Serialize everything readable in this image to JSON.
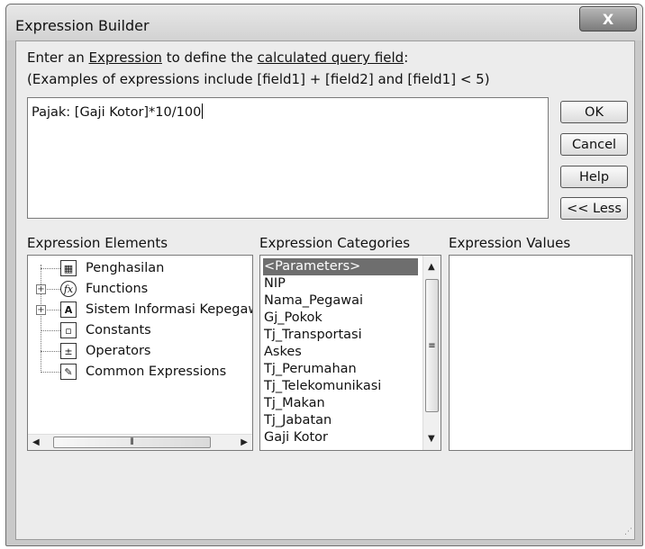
{
  "window": {
    "title": "Expression Builder",
    "close_glyph": "X"
  },
  "header": {
    "line1_prefix": "Enter an ",
    "line1_link1": "Expression",
    "line1_middle": " to define the ",
    "line1_link2": "calculated query field",
    "line1_suffix": ":",
    "line2": "(Examples of expressions include [field1] + [field2] and [field1] < 5)"
  },
  "expression": {
    "value": "Pajak: [Gaji Kotor]*10/100"
  },
  "buttons": {
    "ok": "OK",
    "cancel": "Cancel",
    "help": "Help",
    "less": "<< Less"
  },
  "sections": {
    "elements_label": "Expression Elements",
    "categories_label": "Expression Categories",
    "values_label": "Expression Values"
  },
  "elements": [
    {
      "label": "Penghasilan",
      "icon": "query-icon",
      "expandable": false
    },
    {
      "label": "Functions",
      "icon": "function-icon",
      "expandable": true
    },
    {
      "label": "Sistem Informasi Kepegaw",
      "icon": "database-icon",
      "expandable": true
    },
    {
      "label": "Constants",
      "icon": "constants-icon",
      "expandable": false
    },
    {
      "label": "Operators",
      "icon": "operators-icon",
      "expandable": false
    },
    {
      "label": "Common Expressions",
      "icon": "common-expressions-icon",
      "expandable": false
    }
  ],
  "categories": [
    "<Parameters>",
    "NIP",
    "Nama_Pegawai",
    "Gj_Pokok",
    "Tj_Transportasi",
    "Askes",
    "Tj_Perumahan",
    "Tj_Telekomunikasi",
    "Tj_Makan",
    "Tj_Jabatan",
    "Gaji Kotor"
  ],
  "selected_category": "<Parameters>",
  "colors": {
    "selection": "#6e6e6e",
    "dialog_bg": "#ececec"
  }
}
